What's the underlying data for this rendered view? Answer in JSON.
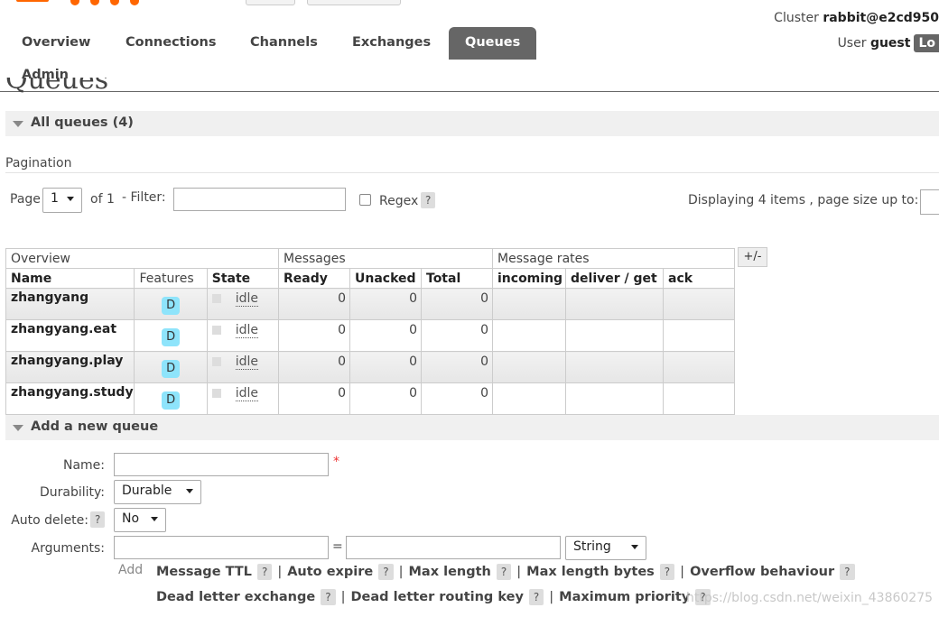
{
  "header": {
    "cluster_label": "Cluster",
    "cluster_name": "rabbit@e2cd950",
    "user_label": "User",
    "user_name": "guest",
    "logout_label": "Lo"
  },
  "nav": {
    "tabs": [
      {
        "label": "Overview",
        "active": false
      },
      {
        "label": "Connections",
        "active": false
      },
      {
        "label": "Channels",
        "active": false
      },
      {
        "label": "Exchanges",
        "active": false
      },
      {
        "label": "Queues",
        "active": true
      },
      {
        "label": "Admin",
        "active": false
      }
    ]
  },
  "page_title": "Queues",
  "all_queues": {
    "heading": "All queues (4)",
    "pagination_label": "Pagination",
    "page_label": "Page",
    "page_value": "1",
    "of_label": "of 1",
    "filter_label": "- Filter:",
    "regex_label": "Regex",
    "help": "?",
    "displaying": "Displaying 4 items , page size up to:"
  },
  "table": {
    "groups": [
      "Overview",
      "Messages",
      "Message rates"
    ],
    "columns": [
      "Name",
      "Features",
      "State",
      "Ready",
      "Unacked",
      "Total",
      "incoming",
      "deliver / get",
      "ack"
    ],
    "toggle": "+/-",
    "rows": [
      {
        "name": "zhangyang",
        "feature": "D",
        "state": "idle",
        "ready": "0",
        "unacked": "0",
        "total": "0"
      },
      {
        "name": "zhangyang.eat",
        "feature": "D",
        "state": "idle",
        "ready": "0",
        "unacked": "0",
        "total": "0"
      },
      {
        "name": "zhangyang.play",
        "feature": "D",
        "state": "idle",
        "ready": "0",
        "unacked": "0",
        "total": "0"
      },
      {
        "name": "zhangyang.study",
        "feature": "D",
        "state": "idle",
        "ready": "0",
        "unacked": "0",
        "total": "0"
      }
    ]
  },
  "add_queue": {
    "heading": "Add a new queue",
    "name_label": "Name:",
    "required_mark": "*",
    "durability_label": "Durability:",
    "durability_value": "Durable",
    "auto_delete_label": "Auto delete:",
    "auto_delete_value": "No",
    "arguments_label": "Arguments:",
    "equals": "=",
    "type_value": "String",
    "add_label": "Add",
    "args_row1": [
      "Message TTL",
      "Auto expire",
      "Max length",
      "Max length bytes",
      "Overflow behaviour"
    ],
    "args_row2": [
      "Dead letter exchange",
      "Dead letter routing key",
      "Maximum priority"
    ]
  },
  "watermark": "https://blog.csdn.net/weixin_43860275"
}
